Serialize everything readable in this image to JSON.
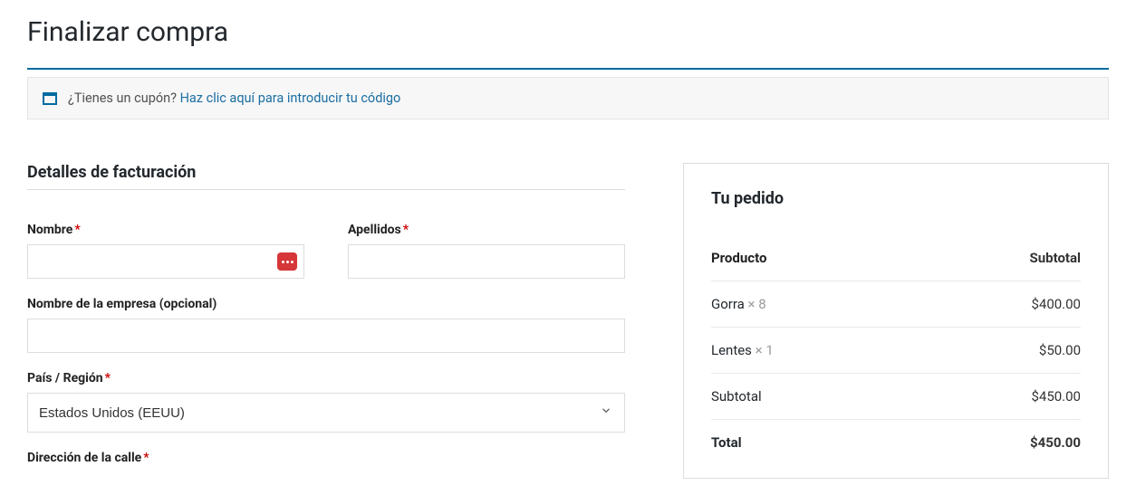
{
  "page": {
    "title": "Finalizar compra"
  },
  "coupon": {
    "prompt": "¿Tienes un cupón?",
    "link": "Haz clic aquí para introducir tu código"
  },
  "billing": {
    "heading": "Detalles de facturación",
    "labels": {
      "first_name": "Nombre",
      "last_name": "Apellidos",
      "company": "Nombre de la empresa (opcional)",
      "country": "País / Región",
      "address": "Dirección de la calle"
    },
    "values": {
      "first_name": "",
      "last_name": "",
      "company": "",
      "country": "Estados Unidos (EEUU)"
    },
    "required_mark": "*"
  },
  "order": {
    "heading": "Tu pedido",
    "columns": {
      "product": "Producto",
      "subtotal": "Subtotal"
    },
    "items": [
      {
        "name": "Gorra",
        "qty_text": "× 8",
        "amount": "$400.00"
      },
      {
        "name": "Lentes",
        "qty_text": "× 1",
        "amount": "$50.00"
      }
    ],
    "subtotal": {
      "label": "Subtotal",
      "amount": "$450.00"
    },
    "total": {
      "label": "Total",
      "amount": "$450.00"
    }
  }
}
